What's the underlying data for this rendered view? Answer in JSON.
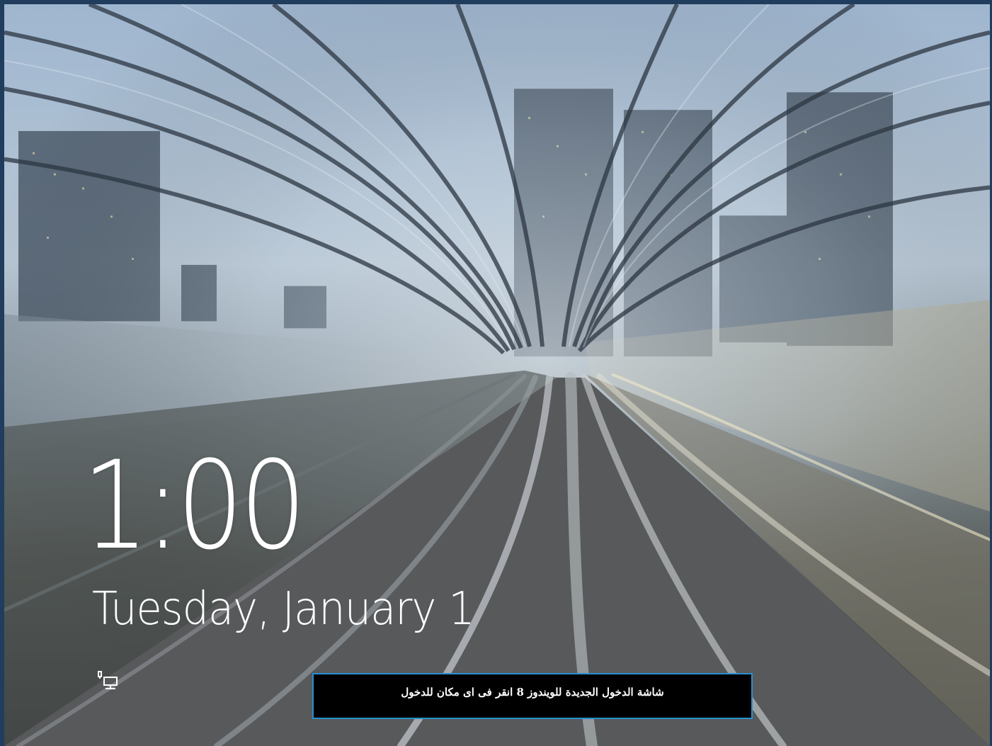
{
  "lockscreen": {
    "time": "1:00",
    "date": "Tuesday, January 1",
    "network_icon": "network-wired-icon"
  },
  "caption": {
    "text": "شاشة الدخول الجديدة للويندوز 8 انقر فى اى مكان للدخول"
  },
  "colors": {
    "frame": "#203d5e",
    "caption_border": "#2a8fd3",
    "caption_bg": "#000000",
    "text": "#ffffff"
  }
}
